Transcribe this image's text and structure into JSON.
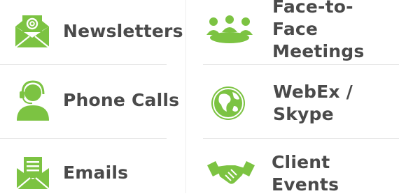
{
  "brand": {
    "accent": "#7cc342",
    "text": "#4a4a4a"
  },
  "items": [
    {
      "icon": "envelope-at-icon",
      "label": "Newsletters"
    },
    {
      "icon": "meeting-group-icon",
      "label": "Face-to-Face Meetings"
    },
    {
      "icon": "headset-person-icon",
      "label": "Phone Calls"
    },
    {
      "icon": "globe-icon",
      "label": "WebEx / Skype"
    },
    {
      "icon": "envelope-letter-icon",
      "label": "Emails"
    },
    {
      "icon": "handshake-icon",
      "label": "Client Events"
    }
  ]
}
